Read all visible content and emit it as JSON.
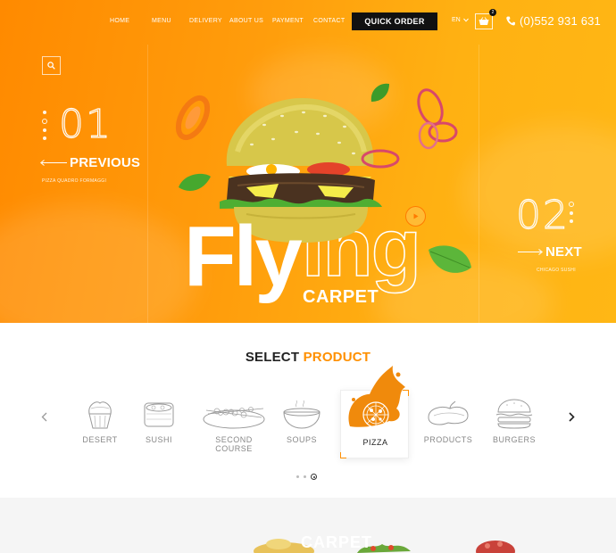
{
  "nav": {
    "items": [
      "HOME",
      "MENU",
      "DELIVERY",
      "ABOUT US",
      "PAYMENT",
      "CONTACT"
    ],
    "quick_order": "QUICK ORDER",
    "lang": "EN",
    "cart_count": "2",
    "phone": "(0)552 931 631"
  },
  "hero": {
    "prev_number": "01",
    "prev_label": "PREVIOUS",
    "prev_sub": "PIZZA QUADRO FORMAGGI",
    "next_number": "02",
    "next_label": "NEXT",
    "next_sub": "CHICAGO SUSHI",
    "title_solid": "Fly",
    "title_outline": "ing",
    "subtitle": "CARPET"
  },
  "products": {
    "title_plain": "SELECT",
    "title_accent": "PRODUCT",
    "categories": [
      {
        "label": "DESERT",
        "icon": "cupcake-icon"
      },
      {
        "label": "SUSHI",
        "icon": "sushi-icon"
      },
      {
        "label": "SECOND COURSE",
        "icon": "skewer-plate-icon"
      },
      {
        "label": "SOUPS",
        "icon": "soup-bowl-icon"
      },
      {
        "label": "PIZZA",
        "icon": "pizza-icon"
      },
      {
        "label": "PRODUCTS",
        "icon": "pepper-icon"
      },
      {
        "label": "BURGERS",
        "icon": "burger-icon"
      }
    ],
    "active_index": 4,
    "pages": 3,
    "active_page": 3
  },
  "bottom": {
    "ghost_word": "CARPET"
  },
  "colors": {
    "accent": "#ff9000",
    "hero_start": "#ff8a00",
    "hero_end": "#ffb715",
    "dark": "#111111"
  }
}
